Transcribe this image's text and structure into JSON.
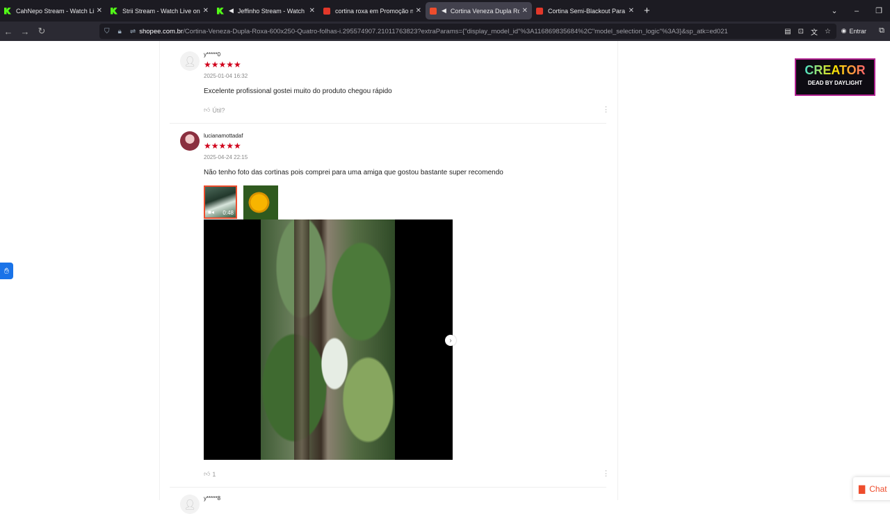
{
  "browser": {
    "tabs": [
      {
        "title": "CahNepo Stream - Watch Live on",
        "icon": "kick-icon",
        "active": false
      },
      {
        "title": "Strii Stream - Watch Live on Kick",
        "icon": "kick-icon",
        "active": false
      },
      {
        "title": "Jeffinho Stream - Watch Live",
        "icon": "kick-icon",
        "active": false
      },
      {
        "title": "cortina roxa em Promoção na Shopee",
        "icon": "shopee-icon",
        "active": false
      },
      {
        "title": "Cortina Veneza Dupla Roxa",
        "icon": "shopee-icon",
        "active": true
      },
      {
        "title": "Cortina Semi-Blackout Para Sala",
        "icon": "shopee-icon",
        "active": false
      }
    ],
    "url_host": "shopee.com.br",
    "url_path": "/Cortina-Veneza-Dupla-Roxa-600x250-Quatro-folhas-i.295574907.21011763823?extraParams={\"display_model_id\"%3A116869835684%2C\"model_selection_logic\"%3A3}&sp_atk=ed021",
    "login_label": "Entrar"
  },
  "reviews": [
    {
      "username": "y*****0",
      "stars": "★★★★★",
      "date": "2025-01-04 16:32",
      "text": "Excelente profissional gostei muito do produto chegou rápido",
      "helpful": "Útil?"
    },
    {
      "username": "lucianamottadaf",
      "stars": "★★★★★",
      "date": "2025-04-24 22:15",
      "text": "Não tenho foto das cortinas pois comprei para uma amiga que gostou bastante super recomendo",
      "video_duration": "0:48",
      "helpful": "1"
    },
    {
      "username": "y*****8"
    }
  ],
  "overlay": {
    "creator_title": "CREATOR",
    "creator_sub": "DEAD BY DAYLIGHT",
    "chat_label": "Chat"
  },
  "colors": {
    "accent": "#ee4d2d",
    "star": "#d0011b",
    "chrome_bg": "#1c1b22"
  }
}
